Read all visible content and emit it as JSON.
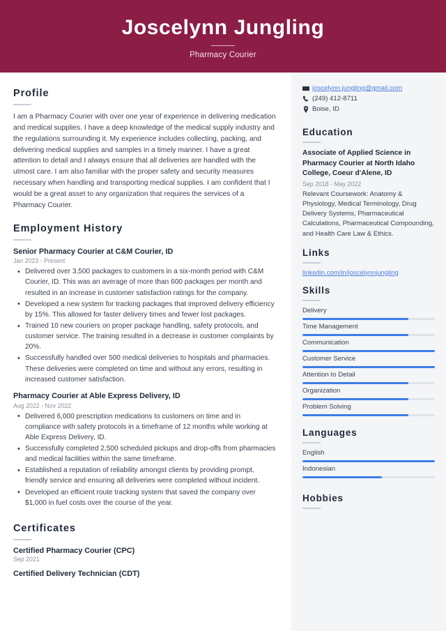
{
  "header": {
    "name": "Joscelynn Jungling",
    "job_title": "Pharmacy Courier",
    "bg_color": "#8c1d45"
  },
  "main": {
    "profile": {
      "heading": "Profile",
      "text": "I am a Pharmacy Courier with over one year of experience in delivering medication and medical supplies. I have a deep knowledge of the medical supply industry and the regulations surrounding it. My experience includes collecting, packing, and delivering medical supplies and samples in a timely manner. I have a great attention to detail and I always ensure that all deliveries are handled with the utmost care. I am also familiar with the proper safety and security measures necessary when handling and transporting medical supplies. I am confident that I would be a great asset to any organization that requires the services of a Pharmacy Courier."
    },
    "employment": {
      "heading": "Employment History",
      "jobs": [
        {
          "title": "Senior Pharmacy Courier at C&M Courier, ID",
          "date": "Jan 2023 - Present",
          "bullets": [
            "Delivered over 3,500 packages to customers in a six-month period with C&M Courier, ID. This was an average of more than 600 packages per month and resulted in an increase in customer satisfaction ratings for the company.",
            "Developed a new system for tracking packages that improved delivery efficiency by 15%. This allowed for faster delivery times and fewer lost packages.",
            "Trained 10 new couriers on proper package handling, safety protocols, and customer service. The training resulted in a decrease in customer complaints by 20%.",
            "Successfully handled over 500 medical deliveries to hospitals and pharmacies. These deliveries were completed on time and without any errors, resulting in increased customer satisfaction."
          ]
        },
        {
          "title": "Pharmacy Courier at Able Express Delivery, ID",
          "date": "Aug 2022 - Nov 2022",
          "bullets": [
            "Delivered 6,000 prescription medications to customers on time and in compliance with safety protocols in a timeframe of 12 months while working at Able Express Delivery, ID.",
            "Successfully completed 2,500 scheduled pickups and drop-offs from pharmacies and medical facilities within the same timeframe.",
            "Established a reputation of reliability amongst clients by providing prompt, friendly service and ensuring all deliveries were completed without incident.",
            "Developed an efficient route tracking system that saved the company over $1,000 in fuel costs over the course of the year."
          ]
        }
      ]
    },
    "certificates": {
      "heading": "Certificates",
      "items": [
        {
          "title": "Certified Pharmacy Courier (CPC)",
          "date": "Sep 2021"
        },
        {
          "title": "Certified Delivery Technician (CDT)",
          "date": ""
        }
      ]
    }
  },
  "sidebar": {
    "contact": [
      {
        "icon": "envelope-icon",
        "value": "joscelynn.jungling@gmail.com",
        "is_link": true
      },
      {
        "icon": "phone-icon",
        "value": "(249) 412-8711",
        "is_link": false
      },
      {
        "icon": "location-pin-icon",
        "value": "Boise, ID",
        "is_link": false
      }
    ],
    "education": {
      "heading": "Education",
      "entries": [
        {
          "title": "Associate of Applied Science in Pharmacy Courier at North Idaho College, Coeur d'Alene, ID",
          "date": "Sep 2018 - May 2022",
          "description": "Relevant Coursework: Anatomy & Physiology, Medical Terminology, Drug Delivery Systems, Pharmaceutical Calculations, Pharmaceutical Compounding, and Health Care Law & Ethics."
        }
      ]
    },
    "links": {
      "heading": "Links",
      "items": [
        "linkedin.com/in/joscelynnjungling"
      ]
    },
    "skills": {
      "heading": "Skills",
      "bar_color": "#3b7de9",
      "items": [
        {
          "label": "Delivery",
          "level": 80
        },
        {
          "label": "Time Management",
          "level": 80
        },
        {
          "label": "Communication",
          "level": 100
        },
        {
          "label": "Customer Service",
          "level": 100
        },
        {
          "label": "Attention to Detail",
          "level": 80
        },
        {
          "label": "Organization",
          "level": 80
        },
        {
          "label": "Problem Solving",
          "level": 80
        }
      ]
    },
    "languages": {
      "heading": "Languages",
      "items": [
        {
          "label": "English",
          "level": 100
        },
        {
          "label": "Indonesian",
          "level": 60
        }
      ]
    },
    "hobbies": {
      "heading": "Hobbies"
    }
  }
}
